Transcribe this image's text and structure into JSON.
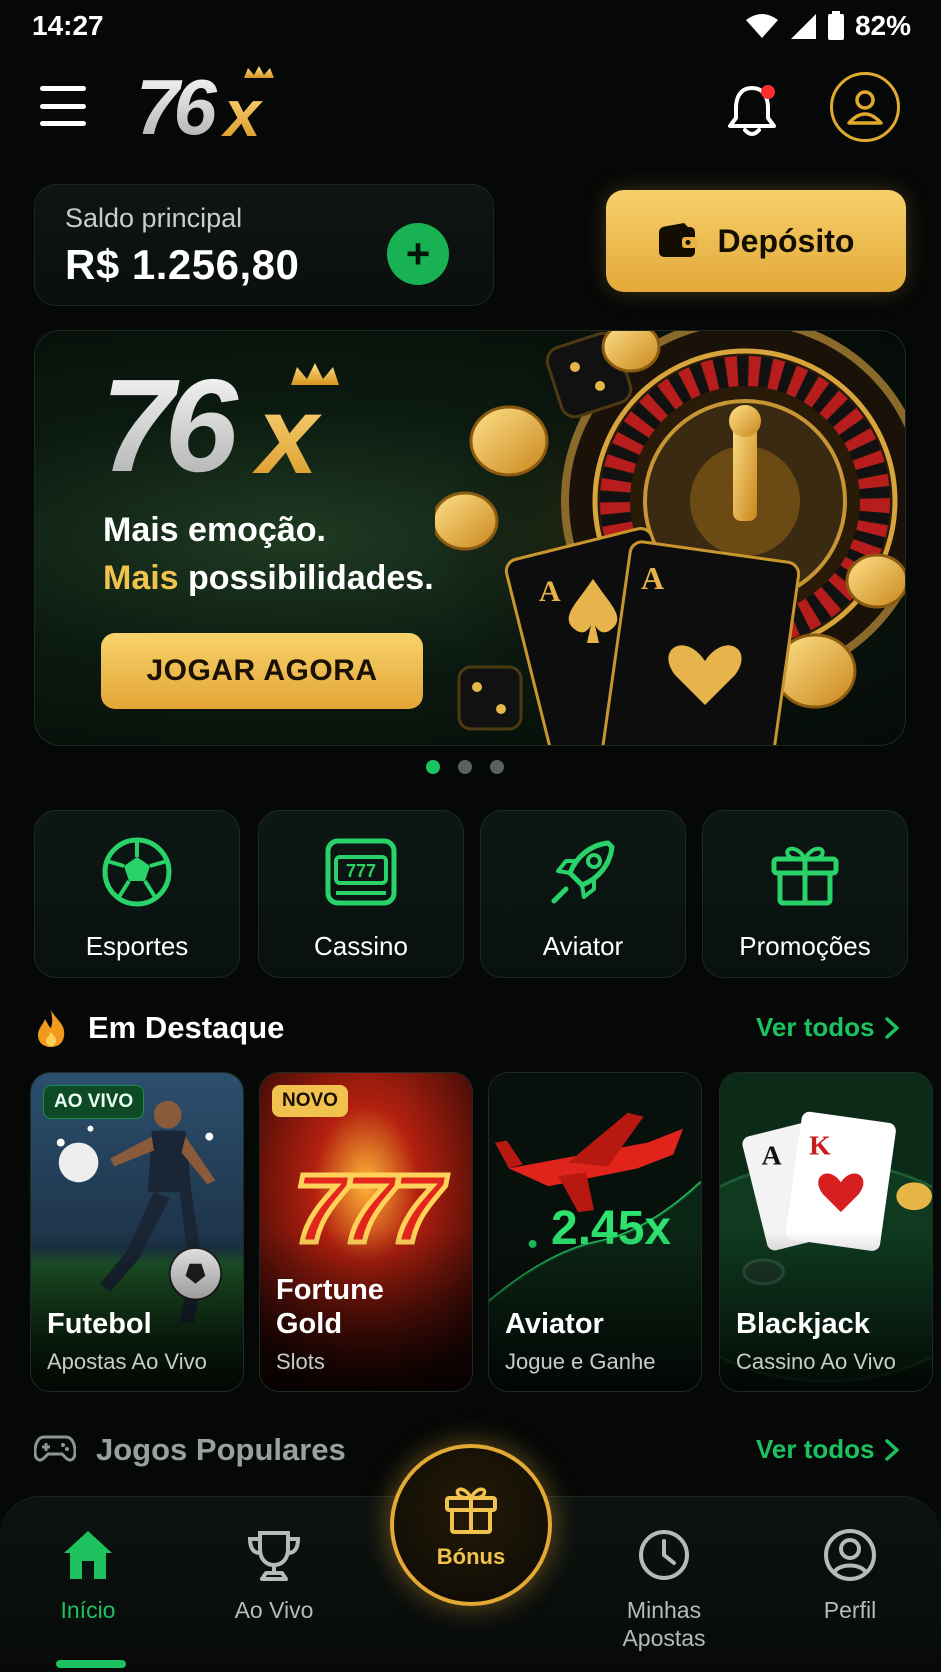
{
  "status_bar": {
    "time": "14:27",
    "battery": "82%"
  },
  "header": {
    "logo_text": "76x",
    "notification_dot_color": "#ff2d2d"
  },
  "balance": {
    "label": "Saldo principal",
    "value": "R$ 1.256,80",
    "add_symbol": "+"
  },
  "deposit": {
    "label": "Depósito"
  },
  "banner": {
    "logo_text": "76x",
    "line1": "Mais emoção.",
    "line2_highlight": "Mais",
    "line2_rest": " possibilidades.",
    "cta": "JOGAR AGORA",
    "slides": 3,
    "active_slide": 1
  },
  "categories": [
    {
      "label": "Esportes",
      "icon": "soccer-ball-icon"
    },
    {
      "label": "Cassino",
      "icon": "slot-machine-icon"
    },
    {
      "label": "Aviator",
      "icon": "rocket-icon"
    },
    {
      "label": "Promoções",
      "icon": "gift-icon"
    }
  ],
  "featured": {
    "title": "Em Destaque",
    "see_all": "Ver todos",
    "games": [
      {
        "badge": "AO VIVO",
        "title": "Futebol",
        "subtitle": "Apostas Ao Vivo"
      },
      {
        "badge": "NOVO",
        "art_text": "777",
        "title": "Fortune Gold",
        "subtitle": "Slots"
      },
      {
        "multiplier": "2.45x",
        "title": "Aviator",
        "subtitle": "Jogue e Ganhe"
      },
      {
        "title": "Blackjack",
        "subtitle": "Cassino Ao Vivo"
      }
    ]
  },
  "popular": {
    "title": "Jogos Populares",
    "see_all": "Ver todos"
  },
  "bottom_nav": {
    "items": [
      {
        "label": "Início",
        "icon": "home-icon",
        "active": true
      },
      {
        "label": "Ao Vivo",
        "icon": "trophy-icon"
      },
      {
        "label": "Bónus",
        "icon": "gift-icon"
      },
      {
        "label": "Minhas Apostas",
        "icon": "clock-icon"
      },
      {
        "label": "Perfil",
        "icon": "user-icon"
      }
    ]
  },
  "colors": {
    "accent_green": "#1dc25f",
    "accent_gold": "#e2a935",
    "background": "#050807"
  }
}
